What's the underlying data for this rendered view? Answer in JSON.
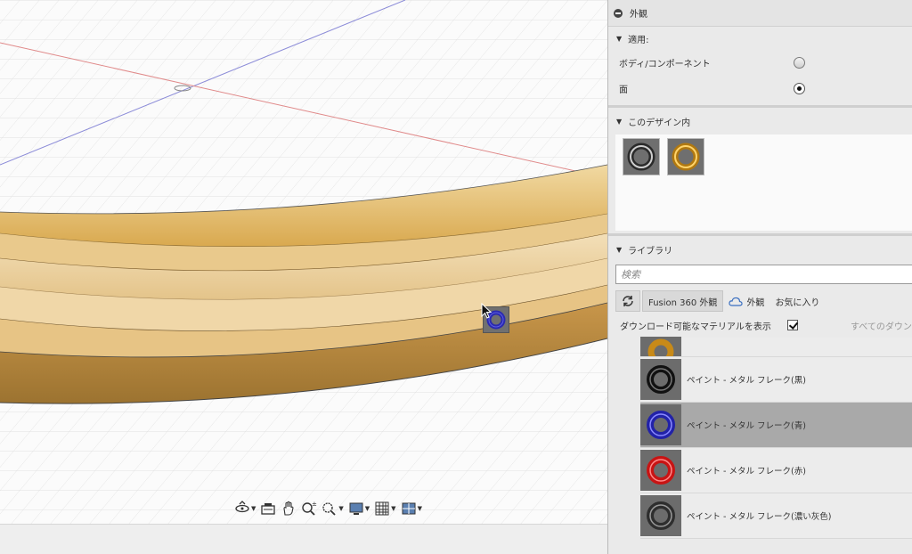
{
  "panel": {
    "title": "外観",
    "apply_section": {
      "heading": "適用:",
      "options": [
        {
          "label": "ボディ/コンポーネント",
          "checked": false
        },
        {
          "label": "面",
          "checked": true
        }
      ]
    },
    "design_section": {
      "heading": "このデザイン内",
      "swatches": [
        {
          "name": "chrome",
          "color": "#7a7a7a"
        },
        {
          "name": "gold",
          "color": "#c88a18"
        }
      ]
    },
    "library_section": {
      "heading": "ライブラリ",
      "search_placeholder": "検索",
      "tabs": [
        {
          "label": "Fusion 360 外観",
          "active": true
        },
        {
          "label": "外観",
          "active": false
        },
        {
          "label": "お気に入り",
          "active": false
        }
      ],
      "download_label": "ダウンロード可能なマテリアルを表示",
      "download_checked": true,
      "all_downloads_label": "すべてのダウン",
      "materials": [
        {
          "label": "",
          "color": "#c88a18",
          "selected": false
        },
        {
          "label": "ペイント - メタル フレーク(黒)",
          "color": "#1c1c1c",
          "selected": false
        },
        {
          "label": "ペイント - メタル フレーク(青)",
          "color": "#2a2ab0",
          "selected": true
        },
        {
          "label": "ペイント - メタル フレーク(赤)",
          "color": "#d01818",
          "selected": false
        },
        {
          "label": "ペイント - メタル フレーク(濃い灰色)",
          "color": "#3a3a3a",
          "selected": false
        }
      ]
    }
  },
  "viewport": {
    "dragged_material_color": "#2a2ab0",
    "body_color": "#e2b868"
  },
  "nav_bar": {
    "tools": [
      "orbit-icon",
      "pan-camera-icon",
      "hand-pan-icon",
      "zoom-icon",
      "fit-zoom-icon",
      "display-settings-icon",
      "grid-icon",
      "viewports-icon"
    ]
  }
}
